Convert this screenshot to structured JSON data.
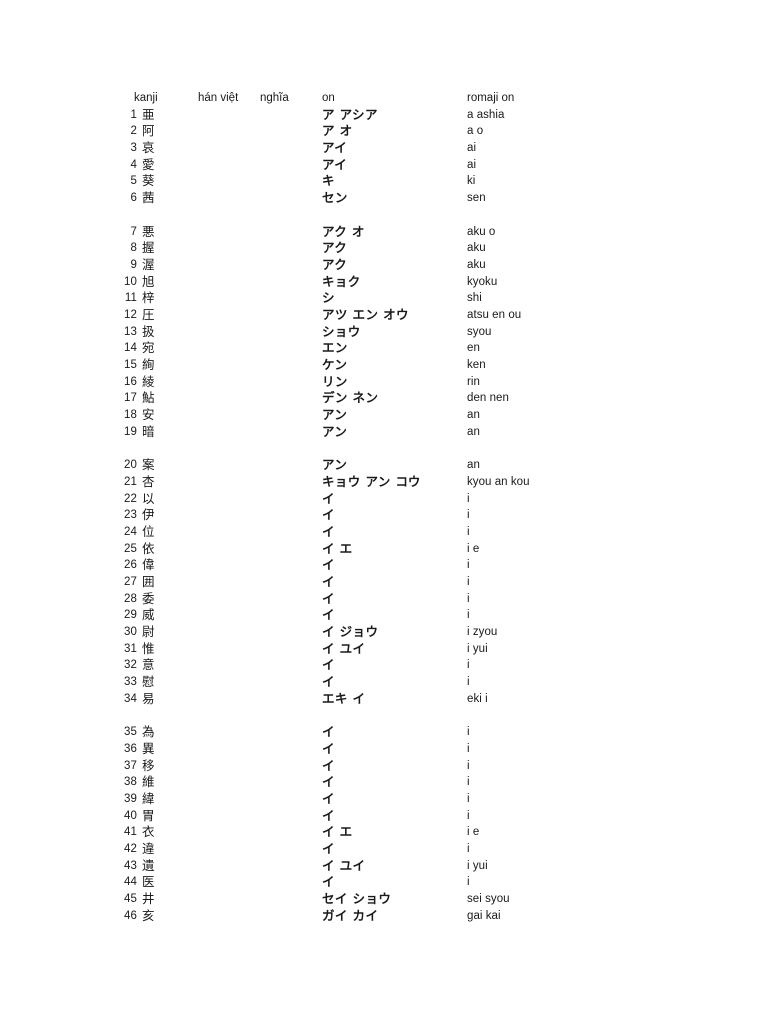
{
  "document": {
    "columns": {
      "number": "",
      "kanji": "kanji",
      "han_viet": "hán việt",
      "nghia": "nghĩa",
      "on": "on",
      "romaji_on": "romaji on"
    },
    "groups": [
      {
        "rows": [
          {
            "num": "1",
            "kanji": "亜",
            "han_viet": "",
            "nghia": "",
            "on": "ア アシア",
            "romaji": "a ashia"
          },
          {
            "num": "2",
            "kanji": "阿",
            "han_viet": "",
            "nghia": "",
            "on": "ア オ",
            "romaji": "a o"
          },
          {
            "num": "3",
            "kanji": "哀",
            "han_viet": "",
            "nghia": "",
            "on": "アイ",
            "romaji": "ai"
          },
          {
            "num": "4",
            "kanji": "愛",
            "han_viet": "",
            "nghia": "",
            "on": "アイ",
            "romaji": "ai"
          },
          {
            "num": "5",
            "kanji": "葵",
            "han_viet": "",
            "nghia": "",
            "on": "キ",
            "romaji": "ki"
          },
          {
            "num": "6",
            "kanji": "茜",
            "han_viet": "",
            "nghia": "",
            "on": "セン",
            "romaji": "sen"
          }
        ]
      },
      {
        "rows": [
          {
            "num": "7",
            "kanji": "悪",
            "han_viet": "",
            "nghia": "",
            "on": "アク オ",
            "romaji": "aku o"
          },
          {
            "num": "8",
            "kanji": "握",
            "han_viet": "",
            "nghia": "",
            "on": "アク",
            "romaji": "aku"
          },
          {
            "num": "9",
            "kanji": "渥",
            "han_viet": "",
            "nghia": "",
            "on": "アク",
            "romaji": "aku"
          },
          {
            "num": "10",
            "kanji": "旭",
            "han_viet": "",
            "nghia": "",
            "on": "キョク",
            "romaji": "kyoku"
          },
          {
            "num": "11",
            "kanji": "梓",
            "han_viet": "",
            "nghia": "",
            "on": "シ",
            "romaji": "shi"
          },
          {
            "num": "12",
            "kanji": "圧",
            "han_viet": "",
            "nghia": "",
            "on": "アツ エン オウ",
            "romaji": "atsu en ou"
          },
          {
            "num": "13",
            "kanji": "扱",
            "han_viet": "",
            "nghia": "",
            "on": "ショウ",
            "romaji": "syou"
          },
          {
            "num": "14",
            "kanji": "宛",
            "han_viet": "",
            "nghia": "",
            "on": "エン",
            "romaji": "en"
          },
          {
            "num": "15",
            "kanji": "絢",
            "han_viet": "",
            "nghia": "",
            "on": "ケン",
            "romaji": "ken"
          },
          {
            "num": "16",
            "kanji": "綾",
            "han_viet": "",
            "nghia": "",
            "on": "リン",
            "romaji": "rin"
          },
          {
            "num": "17",
            "kanji": "鮎",
            "han_viet": "",
            "nghia": "",
            "on": "デン ネン",
            "romaji": "den nen"
          },
          {
            "num": "18",
            "kanji": "安",
            "han_viet": "",
            "nghia": "",
            "on": "アン",
            "romaji": "an"
          },
          {
            "num": "19",
            "kanji": "暗",
            "han_viet": "",
            "nghia": "",
            "on": "アン",
            "romaji": "an"
          }
        ]
      },
      {
        "rows": [
          {
            "num": "20",
            "kanji": "案",
            "han_viet": "",
            "nghia": "",
            "on": "アン",
            "romaji": "an"
          },
          {
            "num": "21",
            "kanji": "杏",
            "han_viet": "",
            "nghia": "",
            "on": "キョウ アン コウ",
            "romaji": "kyou an kou"
          },
          {
            "num": "22",
            "kanji": "以",
            "han_viet": "",
            "nghia": "",
            "on": "イ",
            "romaji": "i"
          },
          {
            "num": "23",
            "kanji": "伊",
            "han_viet": "",
            "nghia": "",
            "on": "イ",
            "romaji": "i"
          },
          {
            "num": "24",
            "kanji": "位",
            "han_viet": "",
            "nghia": "",
            "on": "イ",
            "romaji": "i"
          },
          {
            "num": "25",
            "kanji": "依",
            "han_viet": "",
            "nghia": "",
            "on": "イ エ",
            "romaji": "i e"
          },
          {
            "num": "26",
            "kanji": "偉",
            "han_viet": "",
            "nghia": "",
            "on": "イ",
            "romaji": "i"
          },
          {
            "num": "27",
            "kanji": "囲",
            "han_viet": "",
            "nghia": "",
            "on": "イ",
            "romaji": "i"
          },
          {
            "num": "28",
            "kanji": "委",
            "han_viet": "",
            "nghia": "",
            "on": "イ",
            "romaji": "i"
          },
          {
            "num": "29",
            "kanji": "威",
            "han_viet": "",
            "nghia": "",
            "on": "イ",
            "romaji": "i"
          },
          {
            "num": "30",
            "kanji": "尉",
            "han_viet": "",
            "nghia": "",
            "on": "イ ジョウ",
            "romaji": "i zyou"
          },
          {
            "num": "31",
            "kanji": "惟",
            "han_viet": "",
            "nghia": "",
            "on": "イ ユイ",
            "romaji": "i yui"
          },
          {
            "num": "32",
            "kanji": "意",
            "han_viet": "",
            "nghia": "",
            "on": "イ",
            "romaji": "i"
          },
          {
            "num": "33",
            "kanji": "慰",
            "han_viet": "",
            "nghia": "",
            "on": "イ",
            "romaji": "i"
          },
          {
            "num": "34",
            "kanji": "易",
            "han_viet": "",
            "nghia": "",
            "on": "エキ イ",
            "romaji": "eki i"
          }
        ]
      },
      {
        "rows": [
          {
            "num": "35",
            "kanji": "為",
            "han_viet": "",
            "nghia": "",
            "on": "イ",
            "romaji": "i"
          },
          {
            "num": "36",
            "kanji": "異",
            "han_viet": "",
            "nghia": "",
            "on": "イ",
            "romaji": "i"
          },
          {
            "num": "37",
            "kanji": "移",
            "han_viet": "",
            "nghia": "",
            "on": "イ",
            "romaji": "i"
          },
          {
            "num": "38",
            "kanji": "維",
            "han_viet": "",
            "nghia": "",
            "on": "イ",
            "romaji": "i"
          },
          {
            "num": "39",
            "kanji": "緯",
            "han_viet": "",
            "nghia": "",
            "on": "イ",
            "romaji": "i"
          },
          {
            "num": "40",
            "kanji": "胃",
            "han_viet": "",
            "nghia": "",
            "on": "イ",
            "romaji": "i"
          },
          {
            "num": "41",
            "kanji": "衣",
            "han_viet": "",
            "nghia": "",
            "on": "イ エ",
            "romaji": "i e"
          },
          {
            "num": "42",
            "kanji": "違",
            "han_viet": "",
            "nghia": "",
            "on": "イ",
            "romaji": "i"
          },
          {
            "num": "43",
            "kanji": "遺",
            "han_viet": "",
            "nghia": "",
            "on": "イ ユイ",
            "romaji": "i yui"
          },
          {
            "num": "44",
            "kanji": "医",
            "han_viet": "",
            "nghia": "",
            "on": "イ",
            "romaji": "i"
          },
          {
            "num": "45",
            "kanji": "井",
            "han_viet": "",
            "nghia": "",
            "on": "セイ ショウ",
            "romaji": "sei syou"
          },
          {
            "num": "46",
            "kanji": "亥",
            "han_viet": "",
            "nghia": "",
            "on": "ガイ カイ",
            "romaji": "gai kai"
          }
        ]
      }
    ]
  }
}
